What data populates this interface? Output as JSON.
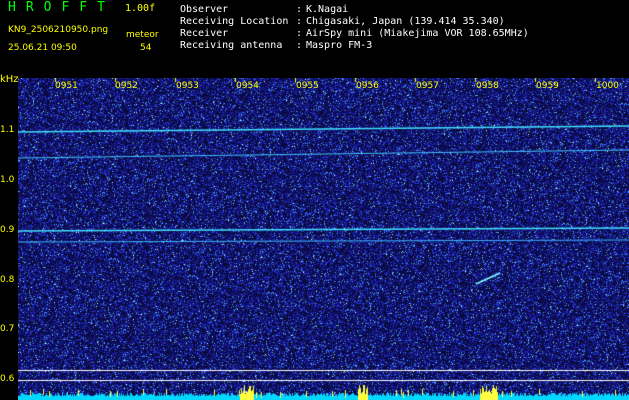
{
  "header": {
    "brand": "HROFFT",
    "version": "1.00f",
    "filename": "KN9_2506210950.png",
    "datetime": "25.06.21 09:50",
    "meteor_label": "meteor",
    "meteor_count": "54"
  },
  "info": [
    {
      "label": "Observer",
      "value": "K.Nagai"
    },
    {
      "label": "Receiving Location",
      "value": "Chigasaki, Japan (139.414 35.340)"
    },
    {
      "label": "Receiver",
      "value": "AirSpy mini (Miakejima VOR 108.65MHz)"
    },
    {
      "label": "Receiving antenna",
      "value": "Maspro FM-3"
    }
  ],
  "spectrogram": {
    "y_unit": "kHz",
    "y_ticks": [
      "1.1",
      "1.0",
      "0.9",
      "0.8",
      "0.7",
      "0.6"
    ],
    "x_ticks": [
      "0951",
      "0952",
      "0953",
      "0954",
      "0955",
      "0956",
      "0957",
      "0958",
      "0959",
      "1000"
    ],
    "colors": {
      "background": "#000000",
      "noise": "#1a1aa0",
      "signal": "#00ffff",
      "labels": "#ffff00"
    }
  }
}
